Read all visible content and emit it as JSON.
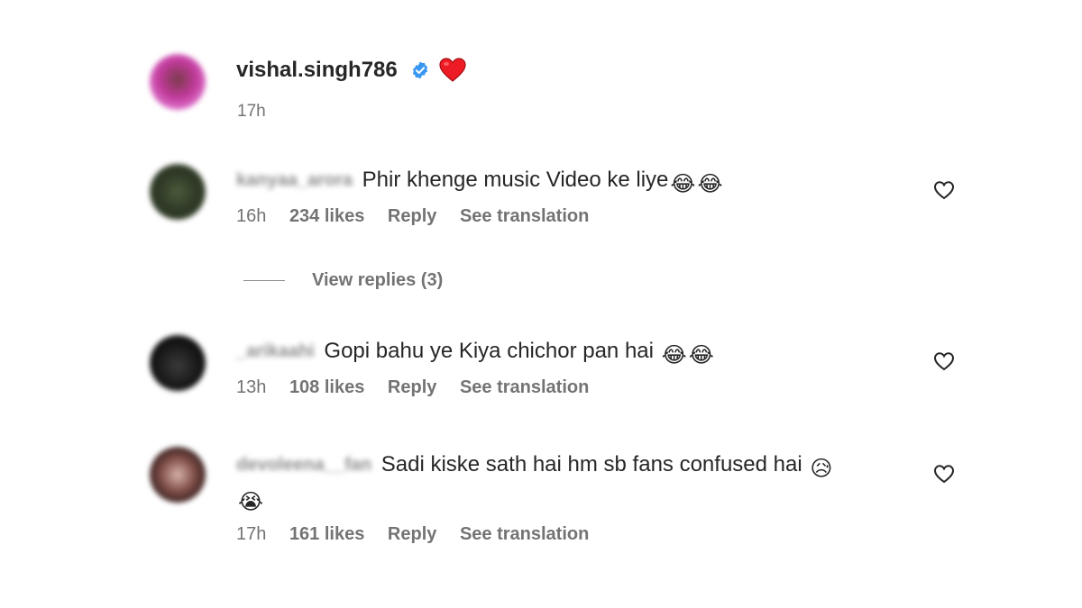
{
  "post": {
    "username": "vishal.singh786",
    "time": "17h"
  },
  "comments": [
    {
      "username": "kanyaa_arora",
      "text": "Phir khenge music Video ke liye",
      "emojis": [
        "😂",
        "😂"
      ],
      "time": "16h",
      "likes": "234 likes",
      "reply_label": "Reply",
      "translate_label": "See translation"
    },
    {
      "username": "_arikaahi",
      "text": "Gopi bahu ye Kiya chichor pan hai",
      "emojis": [
        "😂",
        "😂"
      ],
      "time": "13h",
      "likes": "108 likes",
      "reply_label": "Reply",
      "translate_label": "See translation"
    },
    {
      "username": "devoleena__fan",
      "text": "Sadi kiske sath hai hm sb fans confused hai",
      "emojis": [
        "😥",
        "😭"
      ],
      "time": "17h",
      "likes": "161 likes",
      "reply_label": "Reply",
      "translate_label": "See translation"
    }
  ],
  "view_replies": "View replies (3)",
  "colors": {
    "text": "#262626",
    "secondary": "#737373",
    "verified_blue": "#3897f0",
    "heart_red": "#ed1c24"
  },
  "icons": {
    "verified": "verified-badge-icon",
    "heart_reaction": "red-heart-icon",
    "like": "heart-outline-icon"
  }
}
